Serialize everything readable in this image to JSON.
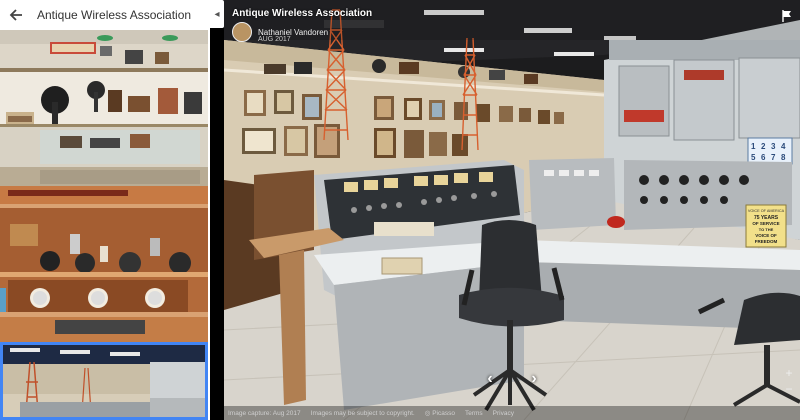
{
  "sidebar": {
    "title": "Antique Wireless Association",
    "back_icon": "arrow-left-icon"
  },
  "pano": {
    "title": "Antique Wireless Association",
    "author": "Nathaniel Vandoren",
    "date": "AUG 2017",
    "placard_lines": [
      "75 YEARS",
      "OF SERVICE",
      "TO THE",
      "VOICE OF",
      "FREEDOM"
    ],
    "placard_top": "VOICE OF AMERICA",
    "counter_digits": [
      "1",
      "2",
      "3",
      "4",
      "5",
      "6",
      "7",
      "8"
    ]
  },
  "controls": {
    "prev_arrow": "‹",
    "next_arrow": "›",
    "zoom_in": "+",
    "zoom_out": "−",
    "collapse_icon": "◂"
  },
  "footer": {
    "capture": "Image capture: Aug 2017",
    "copyright": "Images may be subject to copyright.",
    "picasso": "Picasso",
    "terms": "Terms",
    "privacy": "Privacy"
  },
  "colors": {
    "accent": "#4285f4",
    "wall": "#d9ccb3",
    "panel": "#b8bcbf"
  }
}
